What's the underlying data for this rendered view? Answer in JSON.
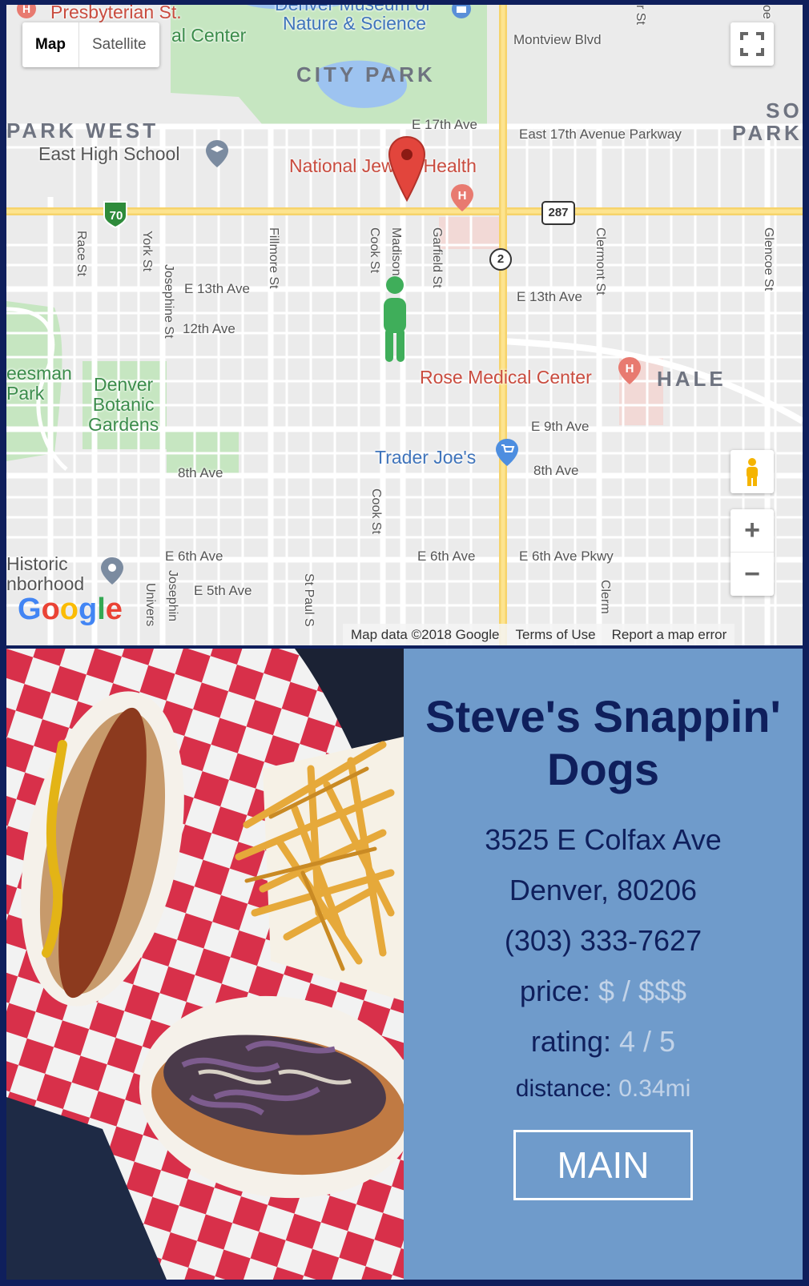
{
  "map": {
    "type_buttons": {
      "map": "Map",
      "satellite": "Satellite"
    },
    "labels": {
      "presbyterian": "Presbyterian St.",
      "medical_center_top": "al Center",
      "museum_top": "Denver Museum of",
      "nature_science": "Nature & Science",
      "montview": "Montview Blvd",
      "city_park": "CITY PARK",
      "park_west": "PARK WEST",
      "east_high": "East High School",
      "e17th": "E 17th Ave",
      "east17_parkway": "East 17th Avenue Parkway",
      "south_park": "SO\nPARK",
      "national_jewish": "National Jewish Health",
      "hwy70": "70",
      "us287": "287",
      "co2": "2",
      "race": "Race St",
      "york": "York St",
      "josephine": "Josephine St",
      "fillmore": "Fillmore St",
      "cook": "Cook St",
      "madison": "Madison St",
      "garfield": "Garfield St",
      "clermont": "Clermont St",
      "glencoe": "Glencoe St",
      "e13th_left": "E 13th Ave",
      "e13th_right": "E 13th Ave",
      "twelfth": "12th Ave",
      "cheesman": "eesman\nPark",
      "botanic": "Denver\nBotanic\nGardens",
      "rose_medical": "Rose Medical Center",
      "hale": "HALE",
      "e9th": "E 9th Ave",
      "trader_joes": "Trader Joe's",
      "eighth_left": "8th Ave",
      "eighth_right": "8th Ave",
      "cook_lower": "Cook St",
      "historic": "Historic\nnborhood",
      "e6th_left": "E 6th Ave",
      "e6th_mid": "E 6th Ave",
      "e6th_pkwy": "E 6th Ave Pkwy",
      "e5th": "E 5th Ave",
      "josephine_lower": "Josephin",
      "university": "Univers",
      "st_paul": "St Paul S",
      "clermont_lower": "Clerm",
      "top_st": "r St",
      "top_oe": "oe S"
    },
    "attribution": {
      "data": "Map data ©2018 Google",
      "terms": "Terms of Use",
      "report": "Report a map error"
    },
    "logo": "Google",
    "zoom_in": "+",
    "zoom_out": "−"
  },
  "restaurant": {
    "name": "Steve's Snappin' Dogs",
    "street": "3525 E Colfax Ave",
    "city_zip": "Denver, 80206",
    "phone": "(303) 333-7627",
    "price_label": "price:",
    "price_value": "$ / $$$",
    "rating_label": "rating:",
    "rating_value": "4 / 5",
    "distance_label": "distance:",
    "distance_value": "0.34mi",
    "button_label": "MAIN"
  },
  "colors": {
    "page_background": "#0f1f5c",
    "info_panel": "#6f9bcb",
    "heading_text": "#0f1f5c",
    "value_text": "#c2d3e8",
    "marker_red": "#e2453c",
    "pegman_green": "#3fae5a"
  },
  "icons": [
    "map-marker-icon",
    "pegman-icon",
    "fullscreen-icon",
    "hospital-icon",
    "school-icon",
    "shopping-cart-icon",
    "landmark-icon",
    "pegman-control-icon"
  ]
}
